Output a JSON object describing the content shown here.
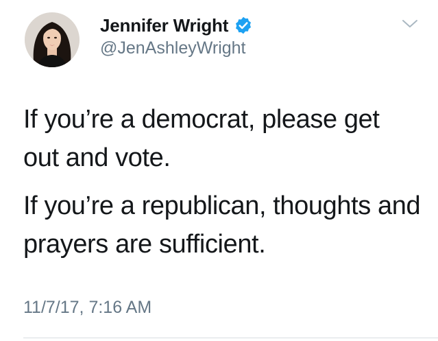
{
  "tweet": {
    "author": {
      "display_name": "Jennifer Wright",
      "handle": "@JenAshleyWright",
      "verified_icon": "verified-badge-icon",
      "avatar_icon": "profile-photo"
    },
    "menu_icon": "chevron-down-icon",
    "text": {
      "paragraph_1": "If you’re a democrat, please get out and vote.",
      "paragraph_2": "If you’re a republican, thoughts and prayers are sufficient."
    },
    "timestamp": "11/7/17, 7:16 AM"
  },
  "colors": {
    "verified_blue": "#1da1f2",
    "secondary_text": "#657786",
    "primary_text": "#14171a"
  }
}
